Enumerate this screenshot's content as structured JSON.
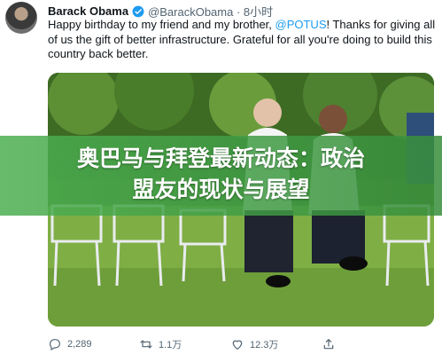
{
  "tweet": {
    "author_name": "Barack Obama",
    "handle_time": "@BarackObama · 8小时",
    "text_before": "Happy birthday to my friend and my brother, ",
    "mention": "@POTUS",
    "text_after": "! Thanks for giving all of us the gift of better infrastructure. Grateful for all you're doing to build this country back better.",
    "accent_color": "#1d9bf0"
  },
  "banner": {
    "line1": "奥巴马与拜登最新动态：政治",
    "line2": "盟友的现状与展望"
  },
  "actions": [
    {
      "icon": "reply-icon",
      "count": "2,289"
    },
    {
      "icon": "retweet-icon",
      "count": "1.1万"
    },
    {
      "icon": "like-icon",
      "count": "12.3万"
    },
    {
      "icon": "share-icon",
      "count": ""
    }
  ]
}
